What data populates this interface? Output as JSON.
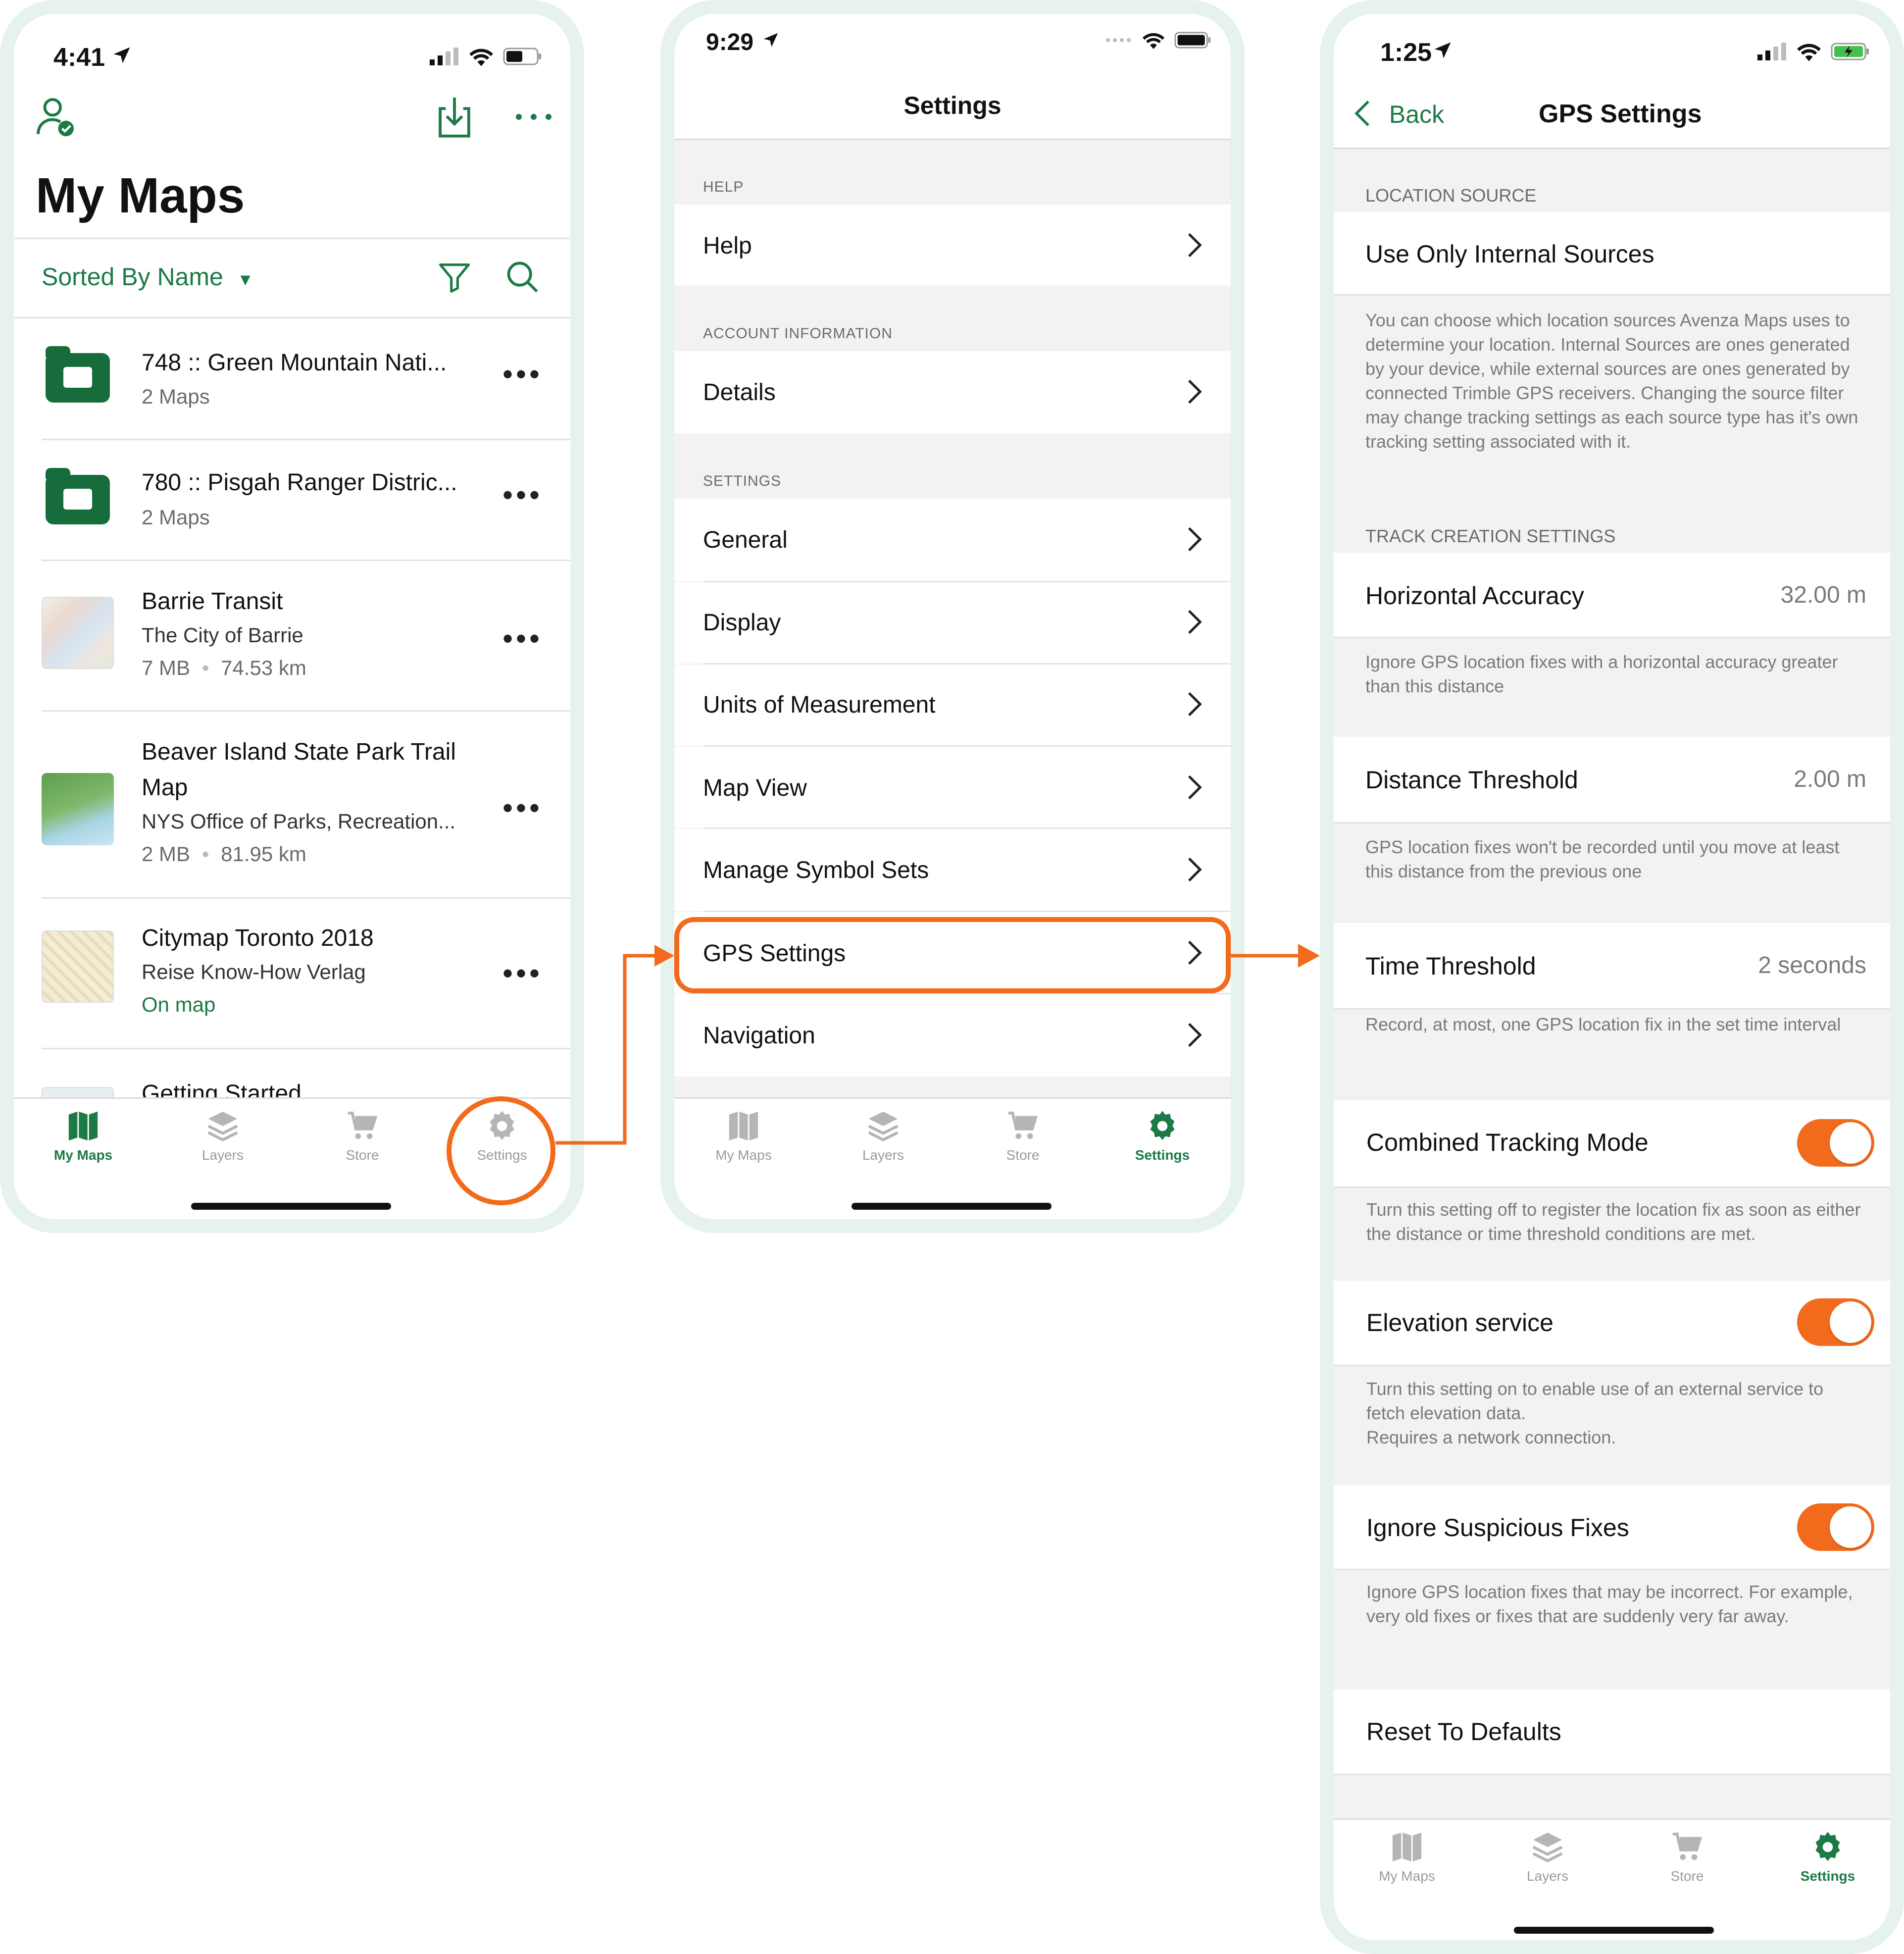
{
  "colors": {
    "brand_green": "#1b7a45",
    "accent_orange": "#f26a1b",
    "frame": "#e6f2ee"
  },
  "screen1": {
    "time": "4:41",
    "title": "My Maps",
    "sort_label": "Sorted By Name",
    "items": [
      {
        "title": "748 :: Green Mountain Nati...",
        "line2": "2 Maps",
        "type": "folder"
      },
      {
        "title": "780 :: Pisgah Ranger Distric...",
        "line2": "2 Maps",
        "type": "folder"
      },
      {
        "title": "Barrie Transit",
        "line2": "The City of Barrie",
        "size": "7 MB",
        "distance": "74.53 km",
        "type": "map"
      },
      {
        "title": "Beaver Island State Park Trail",
        "title2": "Map",
        "line2": "NYS Office of Parks, Recreation...",
        "size": "2 MB",
        "distance": "81.95 km",
        "type": "map"
      },
      {
        "title": "Citymap Toronto 2018",
        "line2": "Reise Know-How Verlag",
        "status": "On map",
        "type": "map"
      },
      {
        "title": "Getting Started",
        "type": "map"
      }
    ]
  },
  "screen2": {
    "time": "9:29",
    "title": "Settings",
    "sections": [
      {
        "header": "HELP",
        "items": [
          "Help"
        ]
      },
      {
        "header": "ACCOUNT INFORMATION",
        "items": [
          "Details"
        ]
      },
      {
        "header": "SETTINGS",
        "items": [
          "General",
          "Display",
          "Units of Measurement",
          "Map View",
          "Manage Symbol Sets",
          "GPS Settings",
          "Navigation"
        ]
      }
    ]
  },
  "screen3": {
    "time": "1:25",
    "back": "Back",
    "title": "GPS Settings",
    "location_source_header": "LOCATION SOURCE",
    "location_source_value": "Use Only Internal Sources",
    "location_source_desc": "You can choose which location sources Avenza Maps uses to determine your location. Internal Sources are ones generated by your device, while external sources are ones generated by connected Trimble GPS receivers. Changing the source filter may change tracking settings as each source type has it's own tracking setting associated with it.",
    "track_header": "TRACK CREATION SETTINGS",
    "horizontal_accuracy": {
      "label": "Horizontal Accuracy",
      "value": "32.00 m",
      "desc": "Ignore GPS location fixes with a horizontal accuracy greater than this distance"
    },
    "distance_threshold": {
      "label": "Distance Threshold",
      "value": "2.00 m",
      "desc": "GPS location fixes won't be recorded until you move at least this distance from the previous one"
    },
    "time_threshold": {
      "label": "Time Threshold",
      "value": "2 seconds",
      "desc": "Record, at most, one GPS location fix in the set time interval"
    },
    "combined_tracking": {
      "label": "Combined Tracking Mode",
      "on": true,
      "desc": "Turn this setting off to register the location fix as soon as either the distance or time threshold conditions are met."
    },
    "elevation_service": {
      "label": "Elevation service",
      "on": true,
      "desc1": "Turn this setting on to enable use of an external service to fetch elevation data.",
      "desc2": "Requires a network connection."
    },
    "ignore_suspicious": {
      "label": "Ignore Suspicious Fixes",
      "on": true,
      "desc": "Ignore GPS location fixes that may be incorrect. For example, very old fixes or fixes that are suddenly very far away."
    },
    "reset": "Reset To Defaults"
  },
  "tabs": [
    "My Maps",
    "Layers",
    "Store",
    "Settings"
  ]
}
